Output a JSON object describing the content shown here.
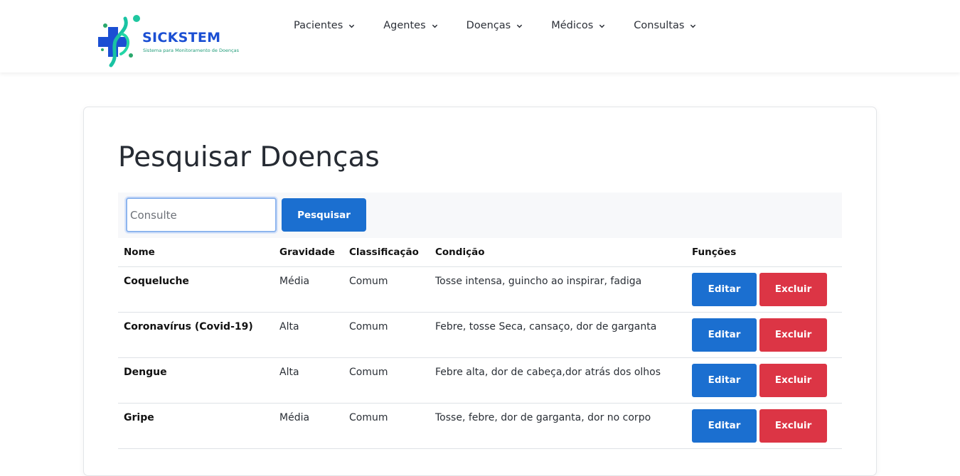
{
  "brand": {
    "title": "SICKSTEM",
    "subtitle": "Sistema para Monitoramento de Doenças",
    "colors": {
      "primary": "#1b4fd3",
      "accent": "#1fc7a0"
    }
  },
  "nav": {
    "items": [
      {
        "label": "Pacientes",
        "icon": "chevron-down-icon"
      },
      {
        "label": "Agentes",
        "icon": "chevron-down-icon"
      },
      {
        "label": "Doenças",
        "icon": "chevron-down-icon"
      },
      {
        "label": "Médicos",
        "icon": "chevron-down-icon"
      },
      {
        "label": "Consultas",
        "icon": "chevron-down-icon"
      }
    ]
  },
  "page": {
    "title": "Pesquisar Doenças"
  },
  "search": {
    "placeholder": "Consulte",
    "value": "",
    "button_label": "Pesquisar"
  },
  "table": {
    "headers": {
      "name": "Nome",
      "severity": "Gravidade",
      "classification": "Classificação",
      "condition": "Condição",
      "functions": "Funções"
    },
    "rows": [
      {
        "name": "Coqueluche",
        "severity": "Média",
        "classification": "Comum",
        "condition": "Tosse intensa, guincho ao inspirar, fadiga",
        "edit_label": "Editar",
        "delete_label": "Excluir"
      },
      {
        "name": "Coronavírus (Covid-19)",
        "severity": "Alta",
        "classification": "Comum",
        "condition": "Febre, tosse Seca, cansaço, dor de garganta",
        "edit_label": "Editar",
        "delete_label": "Excluir"
      },
      {
        "name": "Dengue",
        "severity": "Alta",
        "classification": "Comum",
        "condition": "Febre alta, dor de cabeça,dor atrás dos olhos",
        "edit_label": "Editar",
        "delete_label": "Excluir"
      },
      {
        "name": "Gripe",
        "severity": "Média",
        "classification": "Comum",
        "condition": "Tosse, febre, dor de garganta, dor no corpo",
        "edit_label": "Editar",
        "delete_label": "Excluir"
      }
    ]
  },
  "colors": {
    "edit_button": "#1b6fd0",
    "delete_button": "#dc3545",
    "search_button": "#1b6fd0"
  }
}
